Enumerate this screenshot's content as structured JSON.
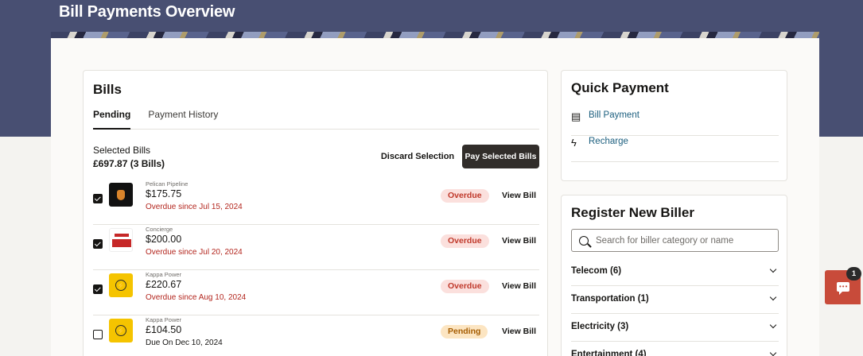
{
  "header": {
    "title": "Bill Payments Overview"
  },
  "bills": {
    "title": "Bills",
    "tabs": [
      {
        "label": "Pending",
        "active": true
      },
      {
        "label": "Payment History",
        "active": false
      }
    ],
    "selection": {
      "label": "Selected Bills",
      "total": "£697.87 (3 Bills)",
      "discard_label": "Discard Selection",
      "pay_label": "Pay Selected Bills"
    },
    "items": [
      {
        "biller": "Pelican Pipeline",
        "amount": "$175.75",
        "due": "Overdue since Jul 15, 2024",
        "status": "Overdue",
        "checked": true,
        "action": "View Bill",
        "logo": "pelican-logo"
      },
      {
        "biller": "Concierge",
        "amount": "$200.00",
        "due": "Overdue since Jul 20, 2024",
        "status": "Overdue",
        "checked": true,
        "action": "View Bill",
        "logo": "concierge-logo"
      },
      {
        "biller": "Kappa Power",
        "amount": "£220.67",
        "due": "Overdue since Aug 10, 2024",
        "status": "Overdue",
        "checked": true,
        "action": "View Bill",
        "logo": "kappa-power-logo"
      },
      {
        "biller": "Kappa Power",
        "amount": "£104.50",
        "due": "Due On Dec 10, 2024",
        "status": "Pending",
        "checked": false,
        "action": "View Bill",
        "logo": "kappa-power-logo"
      }
    ]
  },
  "quick_payment": {
    "title": "Quick Payment",
    "items": [
      {
        "label": "Bill Payment",
        "icon": "bill-icon"
      },
      {
        "label": "Recharge",
        "icon": "lightning-icon"
      }
    ]
  },
  "register": {
    "title": "Register New Biller",
    "search_placeholder": "Search for biller category or name",
    "categories": [
      {
        "label": "Telecom (6)"
      },
      {
        "label": "Transportation (1)"
      },
      {
        "label": "Electricity (3)"
      },
      {
        "label": "Entertainment (4)"
      }
    ]
  },
  "chat": {
    "badge_count": "1"
  },
  "colors": {
    "hero": "#484f72",
    "overdue": "#c0392b",
    "pending": "#a55c00",
    "link": "#1b5e7e",
    "primary_button": "#312d2a",
    "chat": "#c84b3a"
  }
}
